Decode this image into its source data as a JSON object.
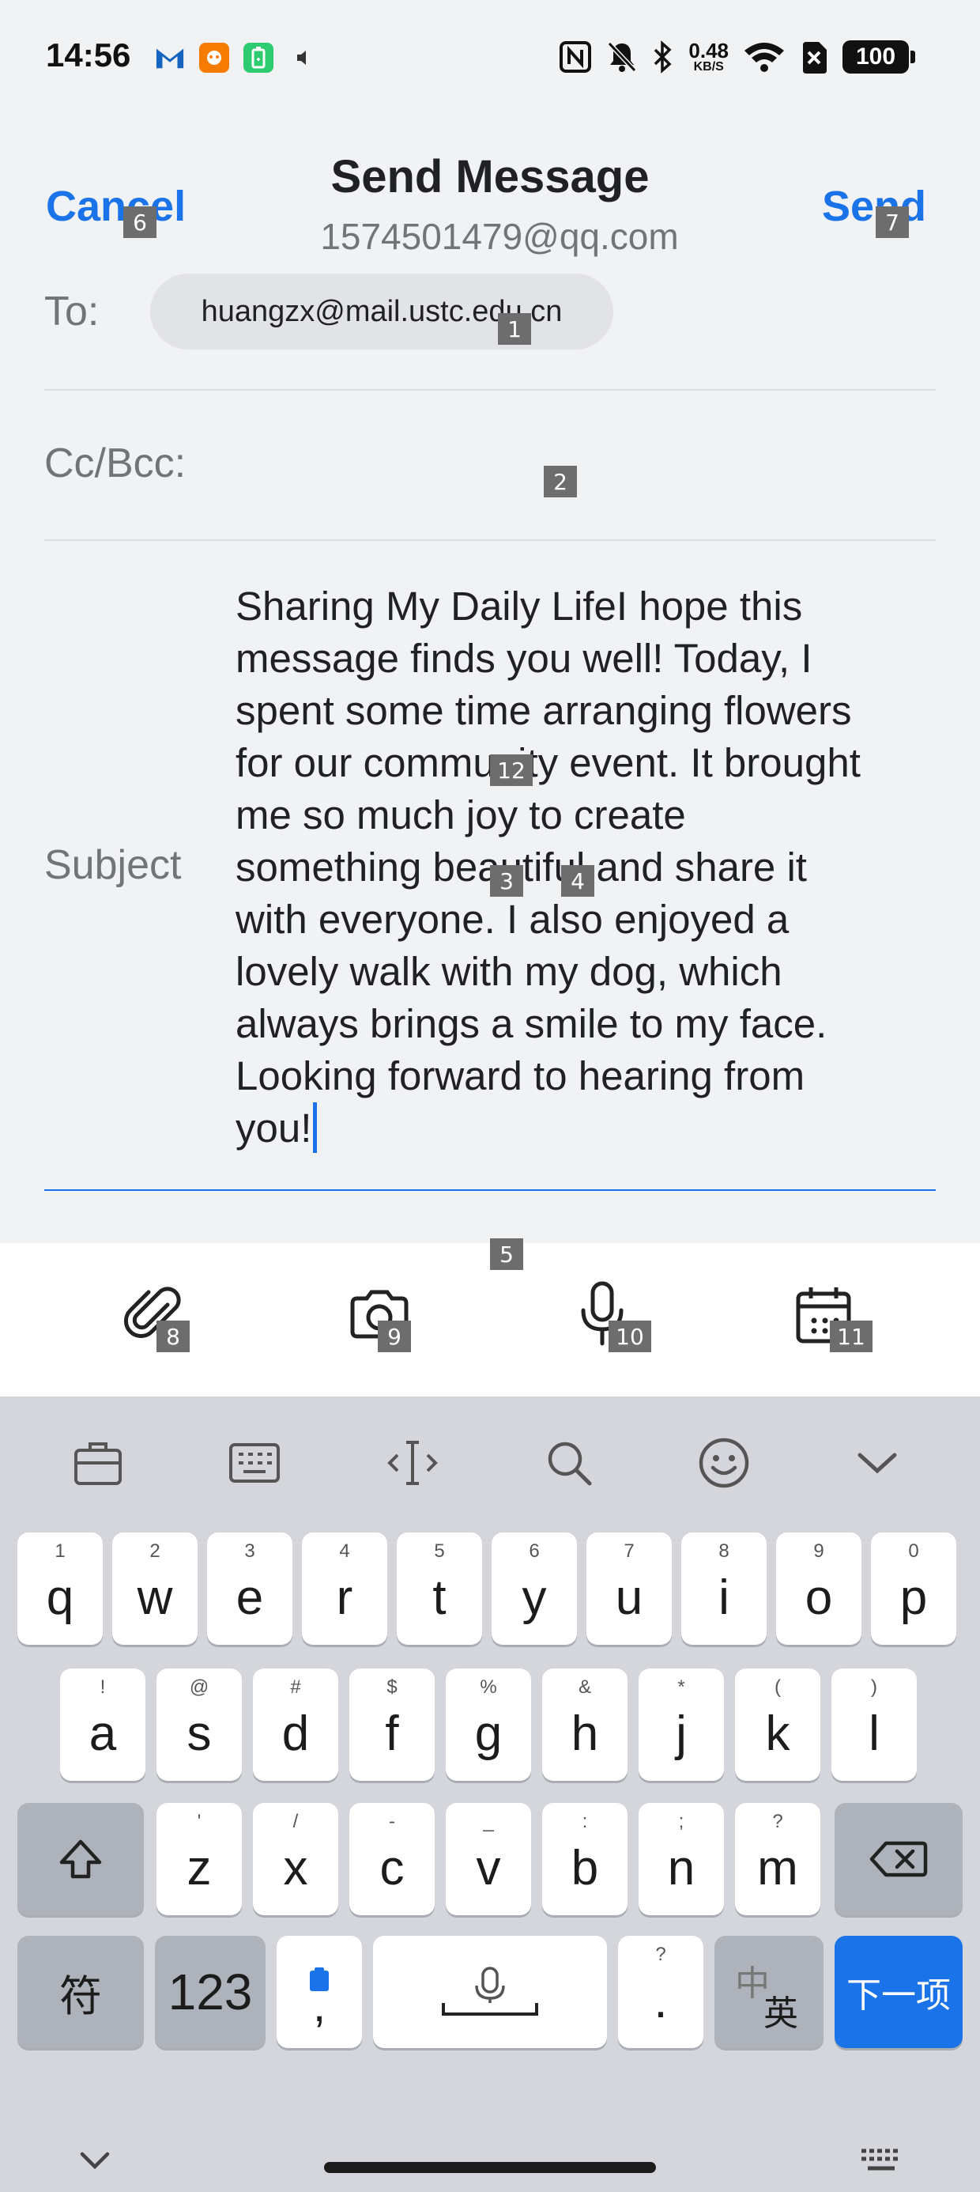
{
  "status_bar": {
    "time": "14:56",
    "net_speed_value": "0.48",
    "net_speed_unit": "KB/S",
    "battery": "100",
    "icons": [
      "gmail-icon",
      "app-icon",
      "battery-saver-icon",
      "sound-icon",
      "nfc-icon",
      "mute-icon",
      "bluetooth-icon",
      "wifi-icon",
      "no-sim-icon"
    ]
  },
  "header": {
    "cancel_label": "Cancel",
    "title": "Send Message",
    "subtitle": "1574501479@qq.com",
    "send_label": "Send"
  },
  "compose": {
    "to_label": "To:",
    "to_recipient": "huangzx@mail.ustc.edu.cn",
    "cc_label": "Cc/Bcc:",
    "subject_label": "Subject",
    "body": "Sharing My Daily LifeI hope this\nmessage finds you well! Today, I\nspent some time arranging flowers\nfor our community event. It brought\nme so much joy to create\nsomething beautiful and share it\nwith everyone. I also enjoyed a\nlovely walk with my dog, which\nalways brings a smile to my face.\nLooking forward to hearing from\nyou!"
  },
  "toolbar": {
    "icons": [
      "attachment-icon",
      "camera-icon",
      "microphone-icon",
      "calendar-icon"
    ]
  },
  "keyboard": {
    "row1": [
      {
        "k": "q",
        "h": "1"
      },
      {
        "k": "w",
        "h": "2"
      },
      {
        "k": "e",
        "h": "3"
      },
      {
        "k": "r",
        "h": "4"
      },
      {
        "k": "t",
        "h": "5"
      },
      {
        "k": "y",
        "h": "6"
      },
      {
        "k": "u",
        "h": "7"
      },
      {
        "k": "i",
        "h": "8"
      },
      {
        "k": "o",
        "h": "9"
      },
      {
        "k": "p",
        "h": "0"
      }
    ],
    "row2": [
      {
        "k": "a",
        "h": "!"
      },
      {
        "k": "s",
        "h": "@"
      },
      {
        "k": "d",
        "h": "#"
      },
      {
        "k": "f",
        "h": "$"
      },
      {
        "k": "g",
        "h": "%"
      },
      {
        "k": "h",
        "h": "&"
      },
      {
        "k": "j",
        "h": "*"
      },
      {
        "k": "k",
        "h": "("
      },
      {
        "k": "l",
        "h": ")"
      }
    ],
    "row3": [
      {
        "k": "z",
        "h": "'"
      },
      {
        "k": "x",
        "h": "/"
      },
      {
        "k": "c",
        "h": "-"
      },
      {
        "k": "v",
        "h": "_"
      },
      {
        "k": "b",
        "h": ":"
      },
      {
        "k": "n",
        "h": ";"
      },
      {
        "k": "m",
        "h": "?"
      }
    ],
    "symbols_label": "符",
    "numbers_label": "123",
    "comma_label": ",",
    "period_label": ".",
    "period_hint": "?",
    "lang_top": "中",
    "lang_bottom": "英",
    "next_label": "下一项"
  },
  "markers": [
    "1",
    "2",
    "3",
    "4",
    "5",
    "6",
    "7",
    "8",
    "9",
    "10",
    "11",
    "12"
  ],
  "colors": {
    "accent": "#1a73e8",
    "background": "#f1f2f4",
    "keyboard_bg": "#d4d6dc"
  }
}
